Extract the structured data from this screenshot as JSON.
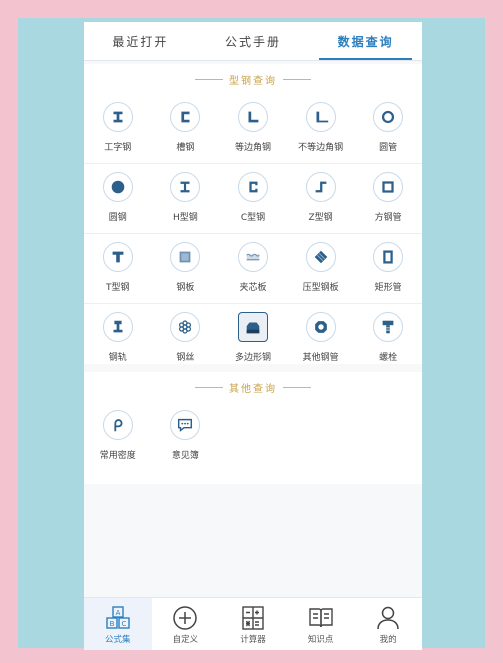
{
  "tabs": [
    "最近打开",
    "公式手册",
    "数据查询"
  ],
  "section1": {
    "title": "型钢查询",
    "rows": [
      [
        {
          "label": "工字钢",
          "icon": "i-beam-icon"
        },
        {
          "label": "槽钢",
          "icon": "channel-steel-icon"
        },
        {
          "label": "等边角钢",
          "icon": "equal-angle-icon"
        },
        {
          "label": "不等边角钢",
          "icon": "unequal-angle-icon"
        },
        {
          "label": "圆管",
          "icon": "round-pipe-icon"
        }
      ],
      [
        {
          "label": "圆钢",
          "icon": "round-bar-icon"
        },
        {
          "label": "H型钢",
          "icon": "h-beam-icon"
        },
        {
          "label": "C型钢",
          "icon": "c-channel-icon"
        },
        {
          "label": "Z型钢",
          "icon": "z-section-icon"
        },
        {
          "label": "方钢管",
          "icon": "square-tube-icon"
        }
      ],
      [
        {
          "label": "T型钢",
          "icon": "t-section-icon"
        },
        {
          "label": "钢板",
          "icon": "steel-plate-icon"
        },
        {
          "label": "夹芯板",
          "icon": "sandwich-panel-icon"
        },
        {
          "label": "压型钢板",
          "icon": "profiled-sheet-icon"
        },
        {
          "label": "矩形管",
          "icon": "rectangular-tube-icon"
        }
      ],
      [
        {
          "label": "钢轨",
          "icon": "rail-icon"
        },
        {
          "label": "钢丝",
          "icon": "wire-icon"
        },
        {
          "label": "多边形钢",
          "icon": "polygon-steel-icon"
        },
        {
          "label": "其他钢管",
          "icon": "other-pipe-icon"
        },
        {
          "label": "螺栓",
          "icon": "bolt-icon"
        }
      ]
    ]
  },
  "section2": {
    "title": "其他查询",
    "items": [
      {
        "label": "常用密度",
        "icon": "density-icon"
      },
      {
        "label": "意见簿",
        "icon": "feedback-icon"
      }
    ]
  },
  "nav": [
    "公式集",
    "自定义",
    "计算器",
    "知识点",
    "我的"
  ],
  "colors": {
    "accent": "#2c7fbf",
    "gold": "#c9a24b",
    "icon_stroke": "#2c5f8a"
  }
}
